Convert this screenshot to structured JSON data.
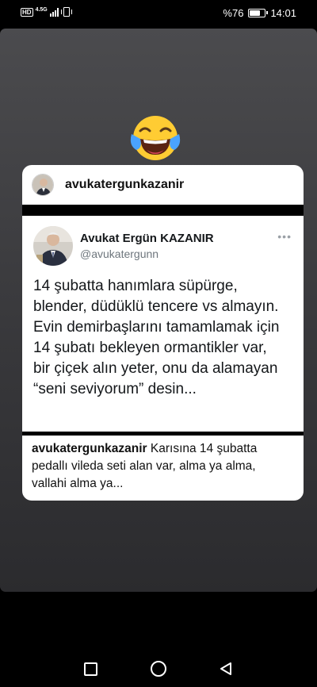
{
  "status_bar": {
    "hd_label": "HD",
    "network_label": "4.5G",
    "battery_text": "%76",
    "battery_level": 0.76,
    "time": "14:01"
  },
  "story": {
    "emoji": "face-with-tears-of-joy",
    "shared_post": {
      "username": "avukatergunkazanir",
      "tweet": {
        "display_name": "Avukat Ergün KAZANIR",
        "handle": "@avukatergunn",
        "lines": [
          "14 şubatta hanımlara süpürge,",
          "blender, düdüklü tencere vs almayın.",
          "Evin demirbaşlarını tamamlamak için",
          "14 şubatı bekleyen ormantikler var,",
          "bir çiçek alın yeter, onu da alamayan",
          "“seni seviyorum” desin..."
        ]
      },
      "caption": {
        "username": "avukatergunkazanir",
        "text": "Karısına 14 şubatta pedallı vileda seti alan var, alma ya alma, vallahi alma ya..."
      }
    }
  },
  "nav": {
    "icons": [
      "recent-apps-icon",
      "home-icon",
      "back-icon"
    ]
  },
  "colors": {
    "card_bg": "#ffffff",
    "handle_gray": "#6e767d",
    "story_bg": "#414144"
  }
}
